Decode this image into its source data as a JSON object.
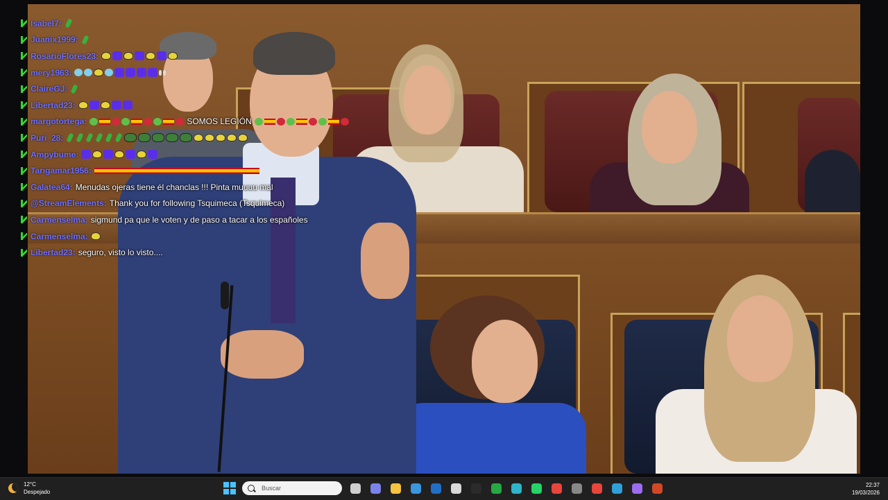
{
  "chat": {
    "messages": [
      {
        "user": "Isabel7",
        "text": "",
        "emotes": [
          "grn"
        ]
      },
      {
        "user": "Juanix1999",
        "text": "",
        "emotes": [
          "grn"
        ]
      },
      {
        "user": "RosarioFlores23",
        "text": "",
        "emotes": [
          "yel",
          "pur",
          "yel",
          "pur",
          "yel",
          "pur",
          "yel"
        ]
      },
      {
        "user": "mery1963",
        "text": "",
        "emotes": [
          "cyan",
          "cyan",
          "yel",
          "cyan",
          "pur",
          "pur",
          "pur",
          "pur",
          "white",
          "white"
        ]
      },
      {
        "user": "ClaireGJ",
        "text": "",
        "emotes": [
          "grn"
        ]
      },
      {
        "user": "Libertad23",
        "text": "",
        "emotes": [
          "yel",
          "pur",
          "yel",
          "pur",
          "pur"
        ]
      },
      {
        "user": "margotortega",
        "text": "SOMOS LEGIÓN",
        "emotes_before": [
          "heart-g",
          "flag",
          "heart-r",
          "heart-g",
          "flag",
          "heart-r",
          "heart-g",
          "flag",
          "heart-r"
        ],
        "emotes": [
          "heart-g",
          "flag",
          "heart-r",
          "heart-g",
          "flag",
          "heart-r",
          "heart-g",
          "flag",
          "heart-r"
        ]
      },
      {
        "user": "Puri_28",
        "text": "",
        "emotes": [
          "grn",
          "grn",
          "grn",
          "grn",
          "grn",
          "grn",
          "frog",
          "frog",
          "frog",
          "frog",
          "frog",
          "yel",
          "yel",
          "yel",
          "yel",
          "yel"
        ]
      },
      {
        "user": "Ampybume",
        "text": "",
        "emotes": [
          "pur",
          "yel",
          "pur",
          "yel",
          "pur",
          "yel",
          "pur"
        ]
      },
      {
        "user": "Tarigamar1956",
        "text": "",
        "flagbar": true
      },
      {
        "user": "Galatea64",
        "text": "Menudas ojeras tiene él chanclas !!! Pinta muuuu mal"
      },
      {
        "user": "@StreamElements",
        "text": "Thank you for following Tsquimeca (Tsquimeca)"
      },
      {
        "user": "Carmenselma",
        "text": "sigmund pa que le voten y de paso a tacar a los españoles"
      },
      {
        "user": "Carmenselma",
        "text": "",
        "emotes": [
          "yel"
        ]
      },
      {
        "user": "Libertad23",
        "text": "seguro, visto lo visto...."
      }
    ]
  },
  "taskbar": {
    "weather": {
      "temp": "12°C",
      "condition": "Despejado"
    },
    "search_placeholder": "Buscar",
    "time": "22:37",
    "date": "19/03/2026",
    "apps": [
      {
        "name": "task-view-icon",
        "color": "#cfcfcf"
      },
      {
        "name": "teams-icon",
        "color": "#7b83eb"
      },
      {
        "name": "file-explorer-icon",
        "color": "#f5c242"
      },
      {
        "name": "microsoft-store-icon",
        "color": "#3a96dd"
      },
      {
        "name": "outlook-icon",
        "color": "#1f6fc5"
      },
      {
        "name": "obs-icon",
        "color": "#d9d9d9"
      },
      {
        "name": "github-icon",
        "color": "#2b2b2b"
      },
      {
        "name": "camtasia-icon",
        "color": "#27a844"
      },
      {
        "name": "edge-icon",
        "color": "#2fb4c9"
      },
      {
        "name": "whatsapp-icon",
        "color": "#25d366"
      },
      {
        "name": "chrome-icon",
        "color": "#e8453c"
      },
      {
        "name": "app-icon",
        "color": "#888888"
      },
      {
        "name": "chrome-profile-icon",
        "color": "#e8453c"
      },
      {
        "name": "teams-badge-icon",
        "color": "#2fa0d8"
      },
      {
        "name": "cortana-icon",
        "color": "#9c6cf0"
      },
      {
        "name": "powerpoint-icon",
        "color": "#d24726"
      }
    ]
  }
}
